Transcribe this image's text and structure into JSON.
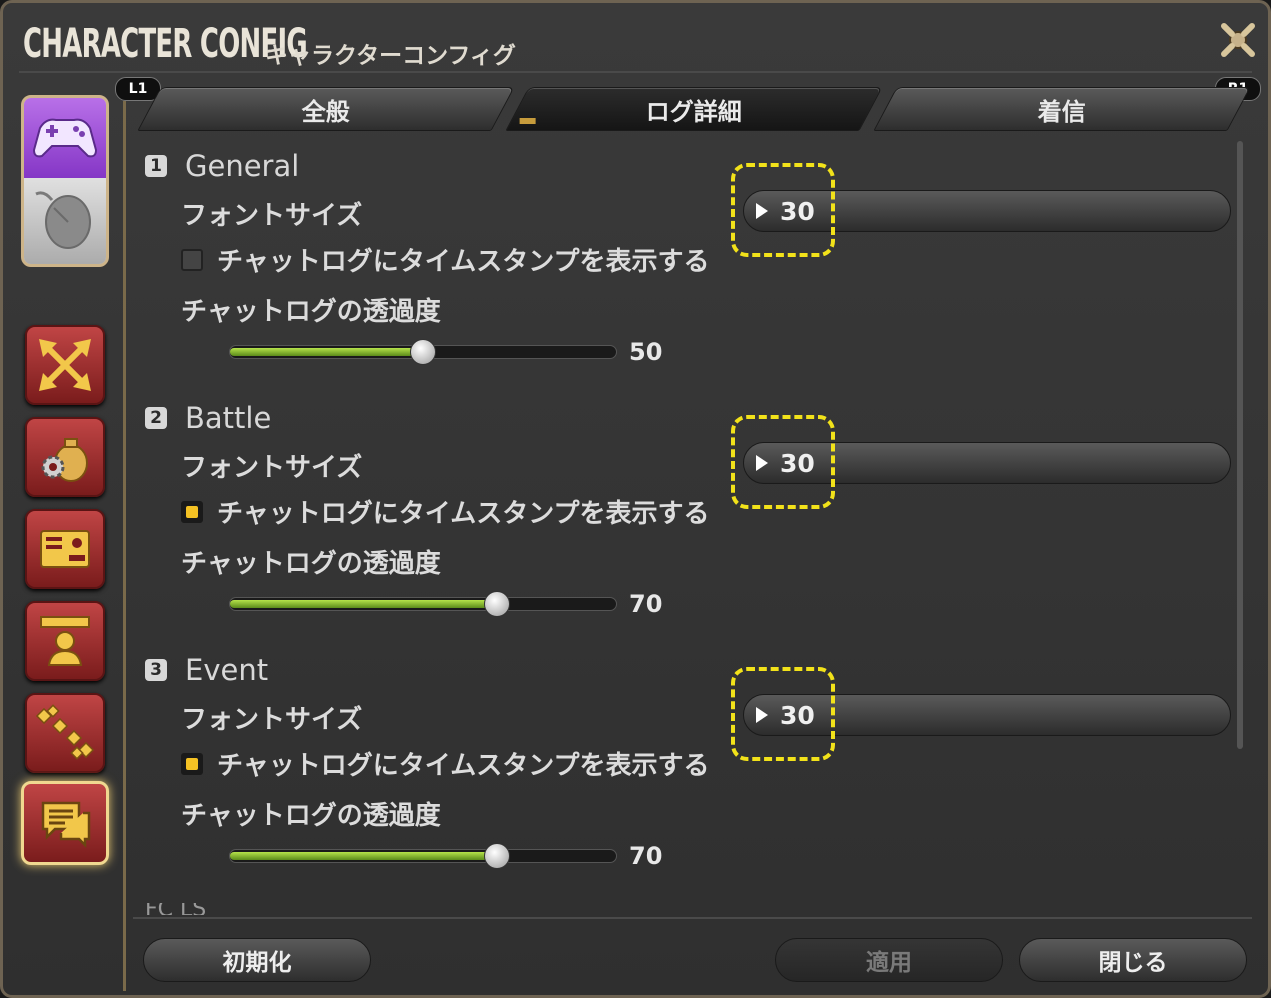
{
  "window": {
    "title_en": "CHARACTER CONFIG",
    "title_jp": "キャラクターコンフィグ"
  },
  "badges": {
    "left": "L1",
    "right": "R1"
  },
  "tabs": [
    {
      "label": "全般",
      "active": false
    },
    {
      "label": "ログ詳細",
      "active": true
    },
    {
      "label": "着信",
      "active": false
    }
  ],
  "sidebar": {
    "device_icons": [
      "gamepad-icon",
      "mouse-icon"
    ],
    "buttons": [
      "arrows-icon",
      "gear-bag-icon",
      "id-card-icon",
      "profile-icon",
      "chain-icon",
      "chat-log-icon"
    ],
    "selected": "chat-log-icon"
  },
  "sections": [
    {
      "number": "1",
      "title": "General",
      "font_label": "フォントサイズ",
      "font_size": "30",
      "timestamp_label": "チャットログにタイムスタンプを表示する",
      "timestamp_checked": false,
      "opacity_label": "チャットログの透過度",
      "opacity": "50"
    },
    {
      "number": "2",
      "title": "Battle",
      "font_label": "フォントサイズ",
      "font_size": "30",
      "timestamp_label": "チャットログにタイムスタンプを表示する",
      "timestamp_checked": true,
      "opacity_label": "チャットログの透過度",
      "opacity": "70"
    },
    {
      "number": "3",
      "title": "Event",
      "font_label": "フォントサイズ",
      "font_size": "30",
      "timestamp_label": "チャットログにタイムスタンプを表示する",
      "timestamp_checked": true,
      "opacity_label": "チャットログの透過度",
      "opacity": "70"
    }
  ],
  "partial_section_title": "FC LS",
  "footer": {
    "reset": "初期化",
    "apply": "適用",
    "close": "閉じる"
  },
  "colors": {
    "highlight": "#f2e21a",
    "checkbox_on": "#f5c224",
    "slider_fill": "#8cc63a",
    "accent_border": "#cdb489"
  }
}
